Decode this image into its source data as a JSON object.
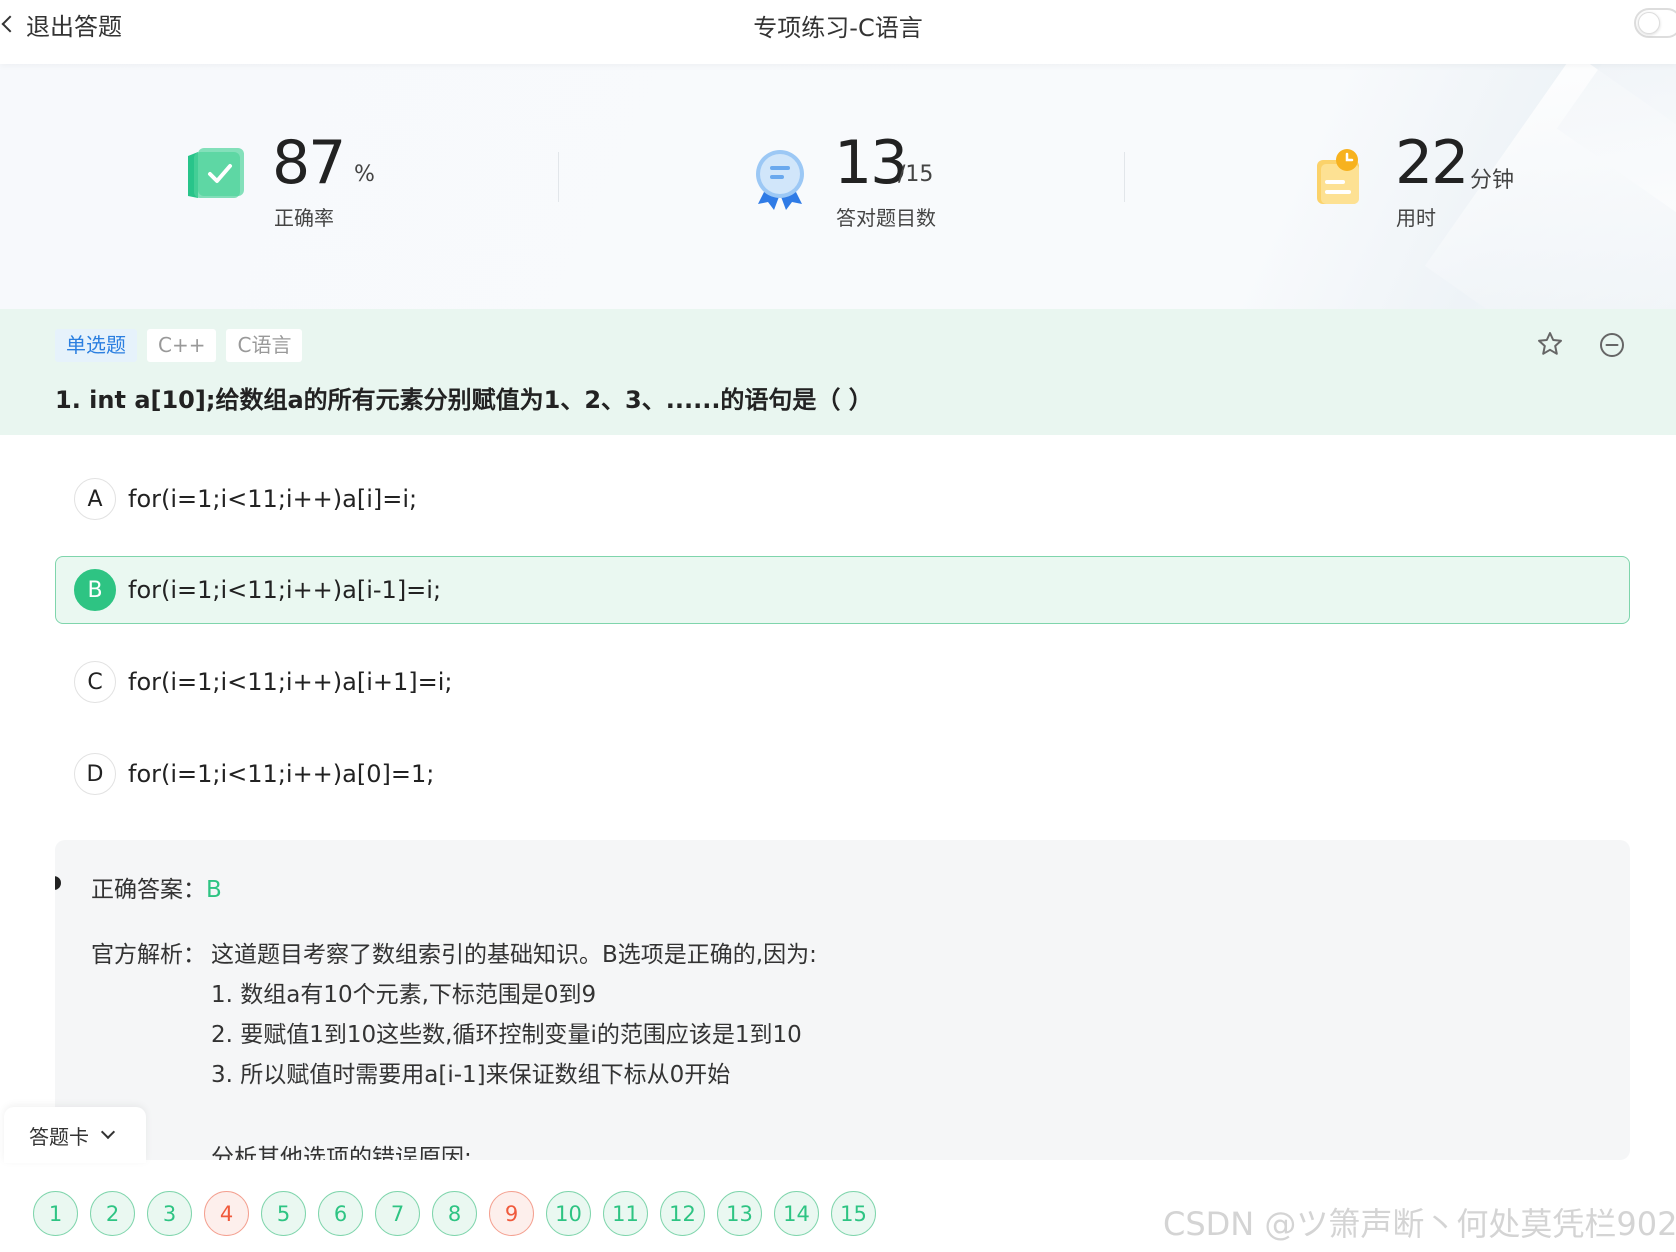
{
  "header": {
    "back_label": "退出答题",
    "title": "专项练习-C语言"
  },
  "stats": {
    "accuracy": {
      "value": "87",
      "unit": "%",
      "label": "正确率"
    },
    "correct_count": {
      "value": "13",
      "unit": "/15",
      "label": "答对题目数"
    },
    "time": {
      "value": "22",
      "unit": "分钟",
      "label": "用时"
    }
  },
  "question": {
    "tags": [
      "单选题",
      "C++",
      "C语言"
    ],
    "text": "1. int a[10];给数组a的所有元素分别赋值为1、2、3、......的语句是（ ）"
  },
  "options": [
    {
      "letter": "A",
      "text": "for(i=1;i<11;i++)a[i]=i;"
    },
    {
      "letter": "B",
      "text": "for(i=1;i<11;i++)a[i-1]=i;"
    },
    {
      "letter": "C",
      "text": "for(i=1;i<11;i++)a[i+1]=i;"
    },
    {
      "letter": "D",
      "text": "for(i=1;i<11;i++)a[0]=1;"
    }
  ],
  "answer": {
    "label": "正确答案：",
    "value": "B",
    "explanation_label": "官方解析：",
    "explanation_lines": [
      "这道题目考察了数组索引的基础知识。B选项是正确的,因为:",
      "1. 数组a有10个元素,下标范围是0到9",
      "2. 要赋值1到10这些数,循环控制变量i的范围应该是1到10",
      "3. 所以赋值时需要用a[i-1]来保证数组下标从0开始",
      "分析其他选项的错误原因:"
    ]
  },
  "answer_card": {
    "label": "答题卡",
    "numbers": [
      "1",
      "2",
      "3",
      "4",
      "5",
      "6",
      "7",
      "8",
      "9",
      "10",
      "11",
      "12",
      "13",
      "14",
      "15"
    ],
    "wrong": [
      "4",
      "9"
    ]
  },
  "watermark": "CSDN @ツ箫声断丶何处莫凭栏902",
  "colors": {
    "accent_green": "#2ec483",
    "wrong_red": "#f05a3c",
    "tag_blue": "#2b7fe0"
  },
  "icons": [
    "chevron-left-icon",
    "accuracy-check-icon",
    "ribbon-badge-icon",
    "clock-note-icon",
    "star-icon",
    "minus-circle-icon",
    "chevron-down-icon"
  ]
}
